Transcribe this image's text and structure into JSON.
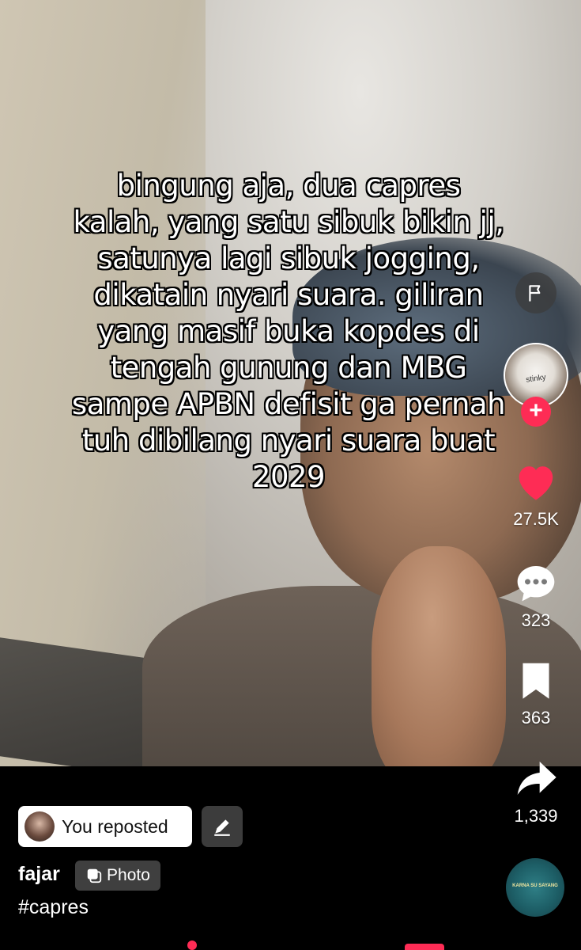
{
  "post": {
    "caption": "bingung aja, dua capres kalah, yang satu sibuk bikin jj, satunya lagi sibuk jogging, dikatain nyari suara. giliran yang masif buka kopdes di tengah gunung dan MBG sampe APBN defisit ga pernah tuh dibilang nyari suara buat 2029",
    "creator_label": "stinky"
  },
  "actions": {
    "likes": "27.5K",
    "comments": "323",
    "saves": "363",
    "shares": "1,339",
    "follow_symbol": "+"
  },
  "footer": {
    "repost_label": "You reposted",
    "username": "fajar",
    "type_badge": "Photo",
    "hashtag": "#capres",
    "music_disc_text": "KARNA SU SAYANG"
  },
  "colors": {
    "like": "#fe2c55",
    "accent": "#fe2c55",
    "text": "#ffffff"
  },
  "icons": [
    "flag-icon",
    "heart-icon",
    "comment-icon",
    "bookmark-icon",
    "share-icon",
    "edit-icon",
    "photo-icon",
    "plus-icon"
  ]
}
